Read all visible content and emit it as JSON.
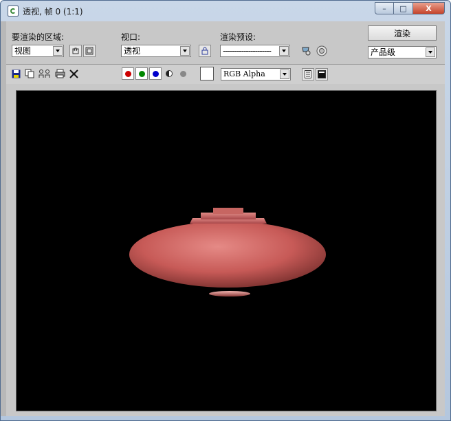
{
  "window": {
    "title": "透视, 帧 0 (1:1)",
    "minimize": "–",
    "maximize": "□",
    "close": "X"
  },
  "controls": {
    "area_label": "要渲染的区域:",
    "area_value": "视图",
    "viewport_label": "视口:",
    "viewport_value": "透视",
    "preset_label": "渲染预设:",
    "preset_value": "---------------------",
    "render_button": "渲染",
    "quality_value": "产品级"
  },
  "toolbar": {
    "channel_value": "RGB Alpha",
    "colors": {
      "red": "#cc0000",
      "green": "#008800",
      "blue": "#0000cc",
      "gray": "#888888"
    }
  },
  "render": {
    "object": "teapot-body",
    "object_color": "#c75a57",
    "background": "#000000"
  }
}
